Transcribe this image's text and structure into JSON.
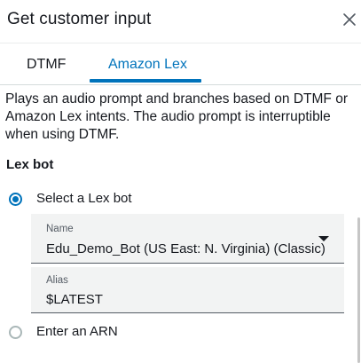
{
  "header": {
    "title": "Get customer input",
    "close_icon": "close-icon"
  },
  "tabs": [
    {
      "label": "DTMF",
      "selected": false
    },
    {
      "label": "Amazon Lex",
      "selected": true
    }
  ],
  "description": "Plays an audio prompt and branches based on DTMF or Amazon Lex intents. The audio prompt is interruptible when using DTMF.",
  "lex_bot": {
    "section_label": "Lex bot",
    "options": [
      {
        "label": "Select a Lex bot",
        "selected": true
      },
      {
        "label": "Enter an ARN",
        "selected": false
      }
    ],
    "name_field": {
      "caption": "Name",
      "value": "Edu_Demo_Bot (US East: N. Virginia) (Classic)"
    },
    "alias_field": {
      "caption": "Alias",
      "value": "$LATEST"
    }
  },
  "colors": {
    "accent": "#0073bb",
    "text": "#16191f",
    "field_bg": "#f2f3f3"
  }
}
